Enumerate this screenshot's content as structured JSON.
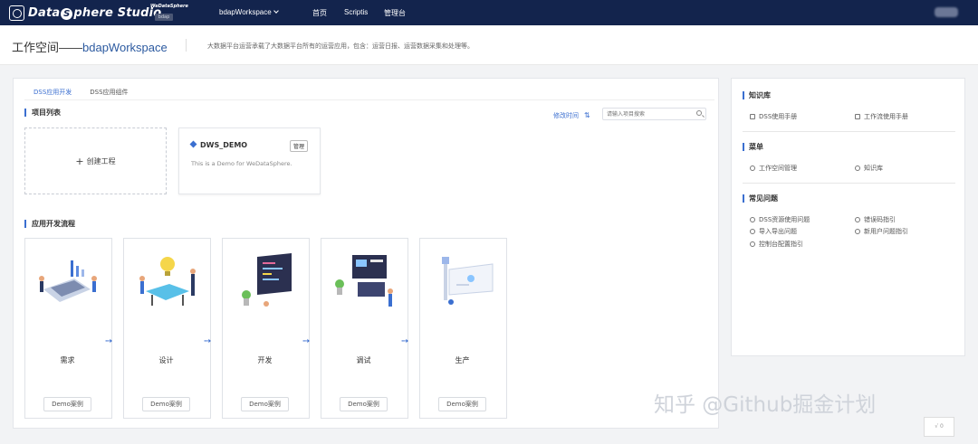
{
  "topbar": {
    "logo_text_1": "Data",
    "logo_s": "S",
    "logo_text_2": "phere Studio",
    "logo_small": "WeDataSphere",
    "logo_badge": "bdap",
    "workspace_select": "bdapWorkspace",
    "nav": [
      "首页",
      "Scriptis",
      "管理台"
    ]
  },
  "header": {
    "title_prefix": "工作空间——",
    "title_workspace": "bdapWorkspace",
    "description": "大数据平台运营承载了大数据平台所有的运营应用，包含：运营日报、运营数据采集和处理等。"
  },
  "tabs": [
    "DSS应用开发",
    "DSS应用组件"
  ],
  "projects": {
    "section_title": "项目列表",
    "sort_label": "修改时间",
    "search_placeholder": "请输入项目搜索",
    "create_label": "创建工程",
    "items": [
      {
        "name": "DWS_DEMO",
        "manage": "管理",
        "desc": "This is a Demo for WeDataSphere."
      }
    ]
  },
  "flow": {
    "section_title": "应用开发流程",
    "stages": [
      {
        "label": "需求",
        "button": "Demo案例"
      },
      {
        "label": "设计",
        "button": "Demo案例"
      },
      {
        "label": "开发",
        "button": "Demo案例"
      },
      {
        "label": "调试",
        "button": "Demo案例"
      },
      {
        "label": "生产",
        "button": "Demo案例"
      }
    ]
  },
  "side": {
    "knowledge_title": "知识库",
    "knowledge_items": [
      "DSS使用手册",
      "工作流使用手册"
    ],
    "menu_title": "菜单",
    "menu_items": [
      "工作空间管理",
      "知识库"
    ],
    "faq_title": "常见问题",
    "faq_items": [
      "DSS资源使用问题",
      "错误码指引",
      "导入导出问题",
      "新用户问题指引",
      "控制台配置指引"
    ]
  },
  "watermark": "知乎 @Github掘金计划",
  "corner_text": "√ 0"
}
